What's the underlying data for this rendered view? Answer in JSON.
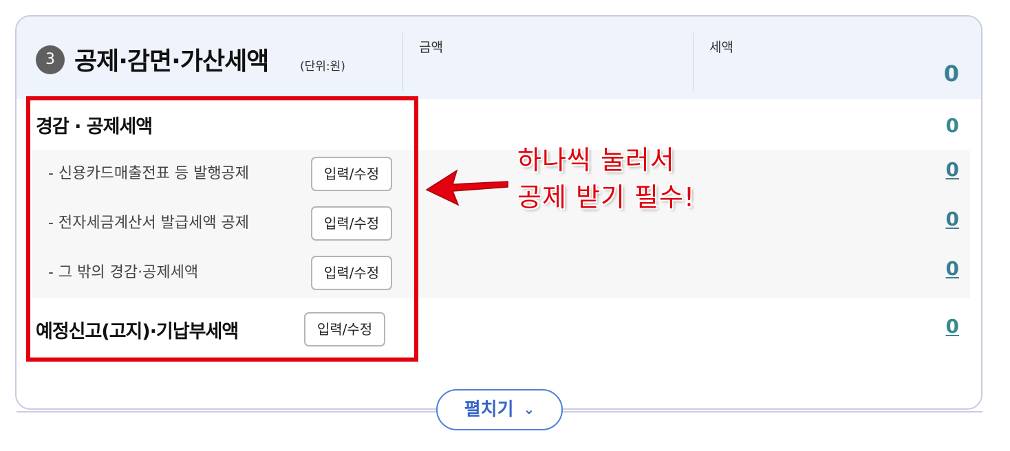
{
  "header": {
    "number": "3",
    "title": "공제·감면·가산세액",
    "unit": "(단위:원)",
    "col_amount": "금액",
    "col_tax": "세액",
    "total": "0"
  },
  "reduction": {
    "title": "경감 · 공제세액",
    "value": "0",
    "rows": [
      {
        "label": "- 신용카드매출전표 등 발행공제",
        "button": "입력/수정",
        "value": "0"
      },
      {
        "label": "- 전자세금계산서 발급세액 공제",
        "button": "입력/수정",
        "value": "0"
      },
      {
        "label": "- 그 밖의 경감·공제세액",
        "button": "입력/수정",
        "value": "0"
      }
    ]
  },
  "prepaid": {
    "title": "예정신고(고지)·기납부세액",
    "button": "입력/수정",
    "value": "0"
  },
  "annotation": {
    "line1": "하나씩 눌러서",
    "line2": "공제 받기 필수!"
  },
  "expand": {
    "label": "펼치기"
  },
  "colors": {
    "highlight_box": "#e3000f",
    "value_teal": "#3a7f92",
    "expand_blue": "#3567c8"
  }
}
